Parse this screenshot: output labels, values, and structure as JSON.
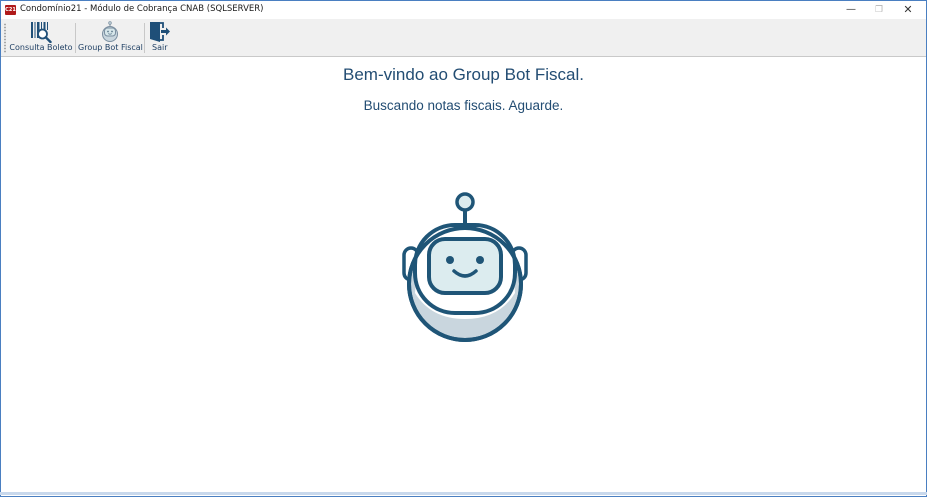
{
  "window": {
    "app_icon_text": "C21",
    "title": "Condomínio21 - Módulo de Cobrança CNAB (SQLSERVER)",
    "controls": {
      "minimize": "—",
      "maximize": "❐",
      "close": "✕"
    }
  },
  "toolbar": {
    "items": [
      {
        "label": "Consulta Boleto",
        "icon": "barcode-search-icon"
      },
      {
        "label": "Group Bot Fiscal",
        "icon": "robot-icon"
      },
      {
        "label": "Sair",
        "icon": "exit-door-icon"
      }
    ]
  },
  "main": {
    "welcome": "Bem-vindo ao Group Bot Fiscal.",
    "status": "Buscando notas fiscais. Aguarde.",
    "illustration": "robot-icon"
  },
  "colors": {
    "text_blue": "#234d73",
    "robot_stroke": "#1f5577",
    "robot_fill": "#dcecef",
    "body_fill": "#c9d6de",
    "titlebar_icon": "#b01a1a"
  }
}
